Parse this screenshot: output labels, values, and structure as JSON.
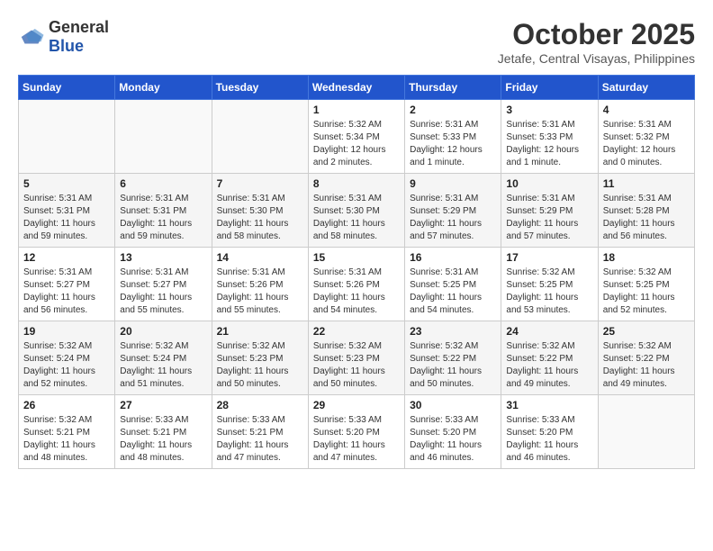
{
  "header": {
    "logo_general": "General",
    "logo_blue": "Blue",
    "month": "October 2025",
    "location": "Jetafe, Central Visayas, Philippines"
  },
  "days_of_week": [
    "Sunday",
    "Monday",
    "Tuesday",
    "Wednesday",
    "Thursday",
    "Friday",
    "Saturday"
  ],
  "weeks": [
    [
      {
        "day": "",
        "info": ""
      },
      {
        "day": "",
        "info": ""
      },
      {
        "day": "",
        "info": ""
      },
      {
        "day": "1",
        "info": "Sunrise: 5:32 AM\nSunset: 5:34 PM\nDaylight: 12 hours\nand 2 minutes."
      },
      {
        "day": "2",
        "info": "Sunrise: 5:31 AM\nSunset: 5:33 PM\nDaylight: 12 hours\nand 1 minute."
      },
      {
        "day": "3",
        "info": "Sunrise: 5:31 AM\nSunset: 5:33 PM\nDaylight: 12 hours\nand 1 minute."
      },
      {
        "day": "4",
        "info": "Sunrise: 5:31 AM\nSunset: 5:32 PM\nDaylight: 12 hours\nand 0 minutes."
      }
    ],
    [
      {
        "day": "5",
        "info": "Sunrise: 5:31 AM\nSunset: 5:31 PM\nDaylight: 11 hours\nand 59 minutes."
      },
      {
        "day": "6",
        "info": "Sunrise: 5:31 AM\nSunset: 5:31 PM\nDaylight: 11 hours\nand 59 minutes."
      },
      {
        "day": "7",
        "info": "Sunrise: 5:31 AM\nSunset: 5:30 PM\nDaylight: 11 hours\nand 58 minutes."
      },
      {
        "day": "8",
        "info": "Sunrise: 5:31 AM\nSunset: 5:30 PM\nDaylight: 11 hours\nand 58 minutes."
      },
      {
        "day": "9",
        "info": "Sunrise: 5:31 AM\nSunset: 5:29 PM\nDaylight: 11 hours\nand 57 minutes."
      },
      {
        "day": "10",
        "info": "Sunrise: 5:31 AM\nSunset: 5:29 PM\nDaylight: 11 hours\nand 57 minutes."
      },
      {
        "day": "11",
        "info": "Sunrise: 5:31 AM\nSunset: 5:28 PM\nDaylight: 11 hours\nand 56 minutes."
      }
    ],
    [
      {
        "day": "12",
        "info": "Sunrise: 5:31 AM\nSunset: 5:27 PM\nDaylight: 11 hours\nand 56 minutes."
      },
      {
        "day": "13",
        "info": "Sunrise: 5:31 AM\nSunset: 5:27 PM\nDaylight: 11 hours\nand 55 minutes."
      },
      {
        "day": "14",
        "info": "Sunrise: 5:31 AM\nSunset: 5:26 PM\nDaylight: 11 hours\nand 55 minutes."
      },
      {
        "day": "15",
        "info": "Sunrise: 5:31 AM\nSunset: 5:26 PM\nDaylight: 11 hours\nand 54 minutes."
      },
      {
        "day": "16",
        "info": "Sunrise: 5:31 AM\nSunset: 5:25 PM\nDaylight: 11 hours\nand 54 minutes."
      },
      {
        "day": "17",
        "info": "Sunrise: 5:32 AM\nSunset: 5:25 PM\nDaylight: 11 hours\nand 53 minutes."
      },
      {
        "day": "18",
        "info": "Sunrise: 5:32 AM\nSunset: 5:25 PM\nDaylight: 11 hours\nand 52 minutes."
      }
    ],
    [
      {
        "day": "19",
        "info": "Sunrise: 5:32 AM\nSunset: 5:24 PM\nDaylight: 11 hours\nand 52 minutes."
      },
      {
        "day": "20",
        "info": "Sunrise: 5:32 AM\nSunset: 5:24 PM\nDaylight: 11 hours\nand 51 minutes."
      },
      {
        "day": "21",
        "info": "Sunrise: 5:32 AM\nSunset: 5:23 PM\nDaylight: 11 hours\nand 50 minutes."
      },
      {
        "day": "22",
        "info": "Sunrise: 5:32 AM\nSunset: 5:23 PM\nDaylight: 11 hours\nand 50 minutes."
      },
      {
        "day": "23",
        "info": "Sunrise: 5:32 AM\nSunset: 5:22 PM\nDaylight: 11 hours\nand 50 minutes."
      },
      {
        "day": "24",
        "info": "Sunrise: 5:32 AM\nSunset: 5:22 PM\nDaylight: 11 hours\nand 49 minutes."
      },
      {
        "day": "25",
        "info": "Sunrise: 5:32 AM\nSunset: 5:22 PM\nDaylight: 11 hours\nand 49 minutes."
      }
    ],
    [
      {
        "day": "26",
        "info": "Sunrise: 5:32 AM\nSunset: 5:21 PM\nDaylight: 11 hours\nand 48 minutes."
      },
      {
        "day": "27",
        "info": "Sunrise: 5:33 AM\nSunset: 5:21 PM\nDaylight: 11 hours\nand 48 minutes."
      },
      {
        "day": "28",
        "info": "Sunrise: 5:33 AM\nSunset: 5:21 PM\nDaylight: 11 hours\nand 47 minutes."
      },
      {
        "day": "29",
        "info": "Sunrise: 5:33 AM\nSunset: 5:20 PM\nDaylight: 11 hours\nand 47 minutes."
      },
      {
        "day": "30",
        "info": "Sunrise: 5:33 AM\nSunset: 5:20 PM\nDaylight: 11 hours\nand 46 minutes."
      },
      {
        "day": "31",
        "info": "Sunrise: 5:33 AM\nSunset: 5:20 PM\nDaylight: 11 hours\nand 46 minutes."
      },
      {
        "day": "",
        "info": ""
      }
    ]
  ]
}
